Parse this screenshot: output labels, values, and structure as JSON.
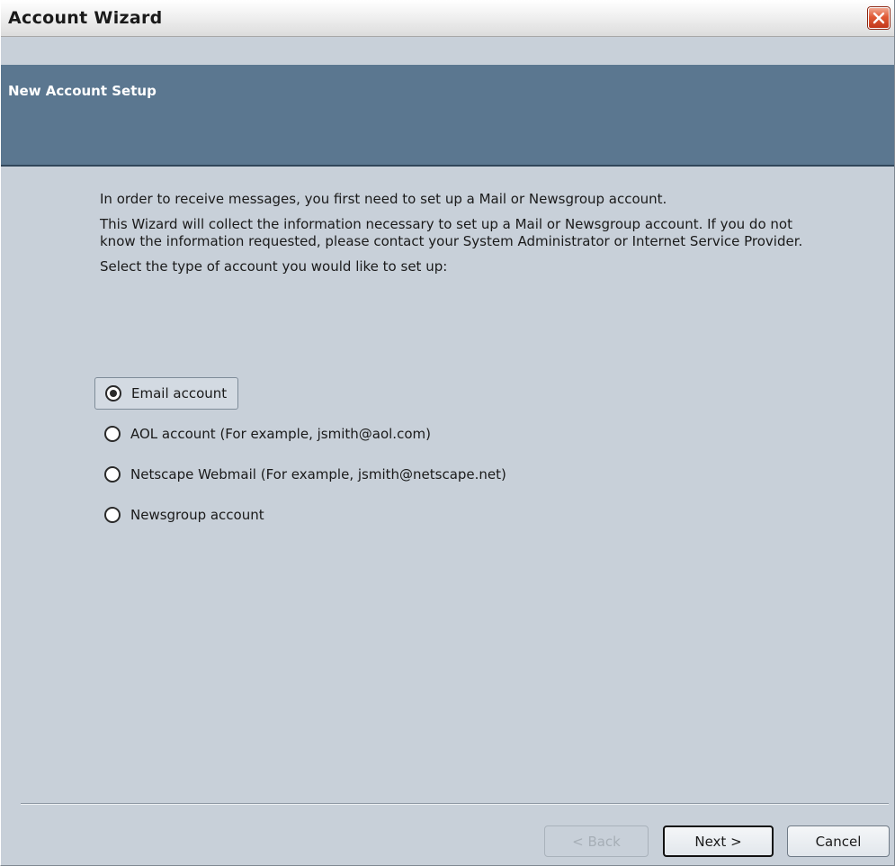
{
  "window": {
    "title": "Account Wizard"
  },
  "banner": {
    "title": "New Account Setup"
  },
  "content": {
    "paragraphs": [
      "In order to receive messages, you first need to set up a Mail or Newsgroup account.",
      "This Wizard will collect the information necessary to set up a Mail or Newsgroup account. If you do not know the information requested, please contact your System Administrator or Internet Service Provider.",
      "Select the type of account you would like to set up:"
    ]
  },
  "account_types": {
    "selected": "Email account",
    "options": [
      {
        "label": "Email account",
        "checked": true
      },
      {
        "label": "AOL account (For example, jsmith@aol.com)",
        "checked": false
      },
      {
        "label": "Netscape Webmail (For example, jsmith@netscape.net)",
        "checked": false
      },
      {
        "label": "Newsgroup account",
        "checked": false
      }
    ]
  },
  "buttons": {
    "back": {
      "label": "< Back",
      "enabled": false
    },
    "next": {
      "label": "Next >",
      "enabled": true,
      "default": true
    },
    "cancel": {
      "label": "Cancel",
      "enabled": true
    }
  },
  "colors": {
    "dialog_background": "#c8d0d9",
    "banner_background": "#5b7790",
    "close_button": "#e05a35"
  },
  "icons": {
    "close": "close-icon"
  }
}
